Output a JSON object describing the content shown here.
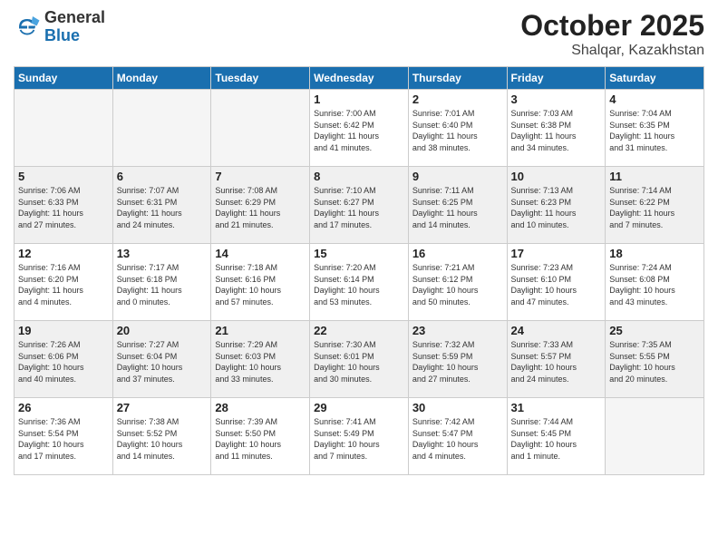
{
  "header": {
    "logo_general": "General",
    "logo_blue": "Blue",
    "month": "October 2025",
    "location": "Shalqar, Kazakhstan"
  },
  "weekdays": [
    "Sunday",
    "Monday",
    "Tuesday",
    "Wednesday",
    "Thursday",
    "Friday",
    "Saturday"
  ],
  "weeks": [
    [
      {
        "num": "",
        "info": ""
      },
      {
        "num": "",
        "info": ""
      },
      {
        "num": "",
        "info": ""
      },
      {
        "num": "1",
        "info": "Sunrise: 7:00 AM\nSunset: 6:42 PM\nDaylight: 11 hours\nand 41 minutes."
      },
      {
        "num": "2",
        "info": "Sunrise: 7:01 AM\nSunset: 6:40 PM\nDaylight: 11 hours\nand 38 minutes."
      },
      {
        "num": "3",
        "info": "Sunrise: 7:03 AM\nSunset: 6:38 PM\nDaylight: 11 hours\nand 34 minutes."
      },
      {
        "num": "4",
        "info": "Sunrise: 7:04 AM\nSunset: 6:35 PM\nDaylight: 11 hours\nand 31 minutes."
      }
    ],
    [
      {
        "num": "5",
        "info": "Sunrise: 7:06 AM\nSunset: 6:33 PM\nDaylight: 11 hours\nand 27 minutes."
      },
      {
        "num": "6",
        "info": "Sunrise: 7:07 AM\nSunset: 6:31 PM\nDaylight: 11 hours\nand 24 minutes."
      },
      {
        "num": "7",
        "info": "Sunrise: 7:08 AM\nSunset: 6:29 PM\nDaylight: 11 hours\nand 21 minutes."
      },
      {
        "num": "8",
        "info": "Sunrise: 7:10 AM\nSunset: 6:27 PM\nDaylight: 11 hours\nand 17 minutes."
      },
      {
        "num": "9",
        "info": "Sunrise: 7:11 AM\nSunset: 6:25 PM\nDaylight: 11 hours\nand 14 minutes."
      },
      {
        "num": "10",
        "info": "Sunrise: 7:13 AM\nSunset: 6:23 PM\nDaylight: 11 hours\nand 10 minutes."
      },
      {
        "num": "11",
        "info": "Sunrise: 7:14 AM\nSunset: 6:22 PM\nDaylight: 11 hours\nand 7 minutes."
      }
    ],
    [
      {
        "num": "12",
        "info": "Sunrise: 7:16 AM\nSunset: 6:20 PM\nDaylight: 11 hours\nand 4 minutes."
      },
      {
        "num": "13",
        "info": "Sunrise: 7:17 AM\nSunset: 6:18 PM\nDaylight: 11 hours\nand 0 minutes."
      },
      {
        "num": "14",
        "info": "Sunrise: 7:18 AM\nSunset: 6:16 PM\nDaylight: 10 hours\nand 57 minutes."
      },
      {
        "num": "15",
        "info": "Sunrise: 7:20 AM\nSunset: 6:14 PM\nDaylight: 10 hours\nand 53 minutes."
      },
      {
        "num": "16",
        "info": "Sunrise: 7:21 AM\nSunset: 6:12 PM\nDaylight: 10 hours\nand 50 minutes."
      },
      {
        "num": "17",
        "info": "Sunrise: 7:23 AM\nSunset: 6:10 PM\nDaylight: 10 hours\nand 47 minutes."
      },
      {
        "num": "18",
        "info": "Sunrise: 7:24 AM\nSunset: 6:08 PM\nDaylight: 10 hours\nand 43 minutes."
      }
    ],
    [
      {
        "num": "19",
        "info": "Sunrise: 7:26 AM\nSunset: 6:06 PM\nDaylight: 10 hours\nand 40 minutes."
      },
      {
        "num": "20",
        "info": "Sunrise: 7:27 AM\nSunset: 6:04 PM\nDaylight: 10 hours\nand 37 minutes."
      },
      {
        "num": "21",
        "info": "Sunrise: 7:29 AM\nSunset: 6:03 PM\nDaylight: 10 hours\nand 33 minutes."
      },
      {
        "num": "22",
        "info": "Sunrise: 7:30 AM\nSunset: 6:01 PM\nDaylight: 10 hours\nand 30 minutes."
      },
      {
        "num": "23",
        "info": "Sunrise: 7:32 AM\nSunset: 5:59 PM\nDaylight: 10 hours\nand 27 minutes."
      },
      {
        "num": "24",
        "info": "Sunrise: 7:33 AM\nSunset: 5:57 PM\nDaylight: 10 hours\nand 24 minutes."
      },
      {
        "num": "25",
        "info": "Sunrise: 7:35 AM\nSunset: 5:55 PM\nDaylight: 10 hours\nand 20 minutes."
      }
    ],
    [
      {
        "num": "26",
        "info": "Sunrise: 7:36 AM\nSunset: 5:54 PM\nDaylight: 10 hours\nand 17 minutes."
      },
      {
        "num": "27",
        "info": "Sunrise: 7:38 AM\nSunset: 5:52 PM\nDaylight: 10 hours\nand 14 minutes."
      },
      {
        "num": "28",
        "info": "Sunrise: 7:39 AM\nSunset: 5:50 PM\nDaylight: 10 hours\nand 11 minutes."
      },
      {
        "num": "29",
        "info": "Sunrise: 7:41 AM\nSunset: 5:49 PM\nDaylight: 10 hours\nand 7 minutes."
      },
      {
        "num": "30",
        "info": "Sunrise: 7:42 AM\nSunset: 5:47 PM\nDaylight: 10 hours\nand 4 minutes."
      },
      {
        "num": "31",
        "info": "Sunrise: 7:44 AM\nSunset: 5:45 PM\nDaylight: 10 hours\nand 1 minute."
      },
      {
        "num": "",
        "info": ""
      }
    ]
  ],
  "colors": {
    "header_bg": "#1a6faf",
    "shaded_row": "#f0f0f0",
    "white_row": "#ffffff"
  }
}
